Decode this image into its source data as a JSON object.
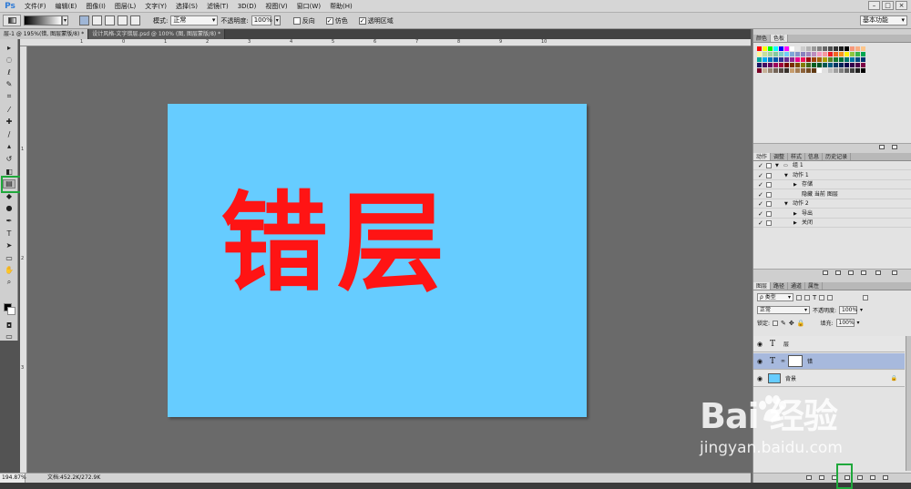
{
  "app": {
    "logo": "Ps",
    "menu": [
      "文件(F)",
      "编辑(E)",
      "图像(I)",
      "图层(L)",
      "文字(Y)",
      "选择(S)",
      "滤镜(T)",
      "3D(D)",
      "视图(V)",
      "窗口(W)",
      "帮助(H)"
    ],
    "window_buttons": [
      "–",
      "□",
      "×"
    ]
  },
  "options_bar": {
    "mode_label": "模式:",
    "mode_value": "正常",
    "opacity_label": "不透明度:",
    "opacity_value": "100%",
    "reverse_label": "反向",
    "dither_label": "仿色",
    "transparency_label": "透明区域",
    "reverse_checked": false,
    "dither_checked": true,
    "transparency_checked": true,
    "workspace": "基本功能"
  },
  "document_tabs": [
    {
      "title": "层-1 @ 195%(错, 图层蒙版/8) *",
      "active": true
    },
    {
      "title": "设计风格-文字错层.psd @ 100% (图, 图层蒙版/8) *",
      "active": false
    }
  ],
  "rulers": {
    "top_ticks": [
      "1",
      "0",
      "1",
      "2",
      "3",
      "4",
      "5",
      "6",
      "7",
      "8",
      "9",
      "10"
    ],
    "left_ticks": [
      "1",
      "2",
      "3"
    ]
  },
  "toolbox": {
    "tools": [
      {
        "name": "move-tool-icon",
        "glyph": "▸"
      },
      {
        "name": "marquee-tool-icon",
        "glyph": "◌"
      },
      {
        "name": "lasso-tool-icon",
        "glyph": "ℓ"
      },
      {
        "name": "quick-select-tool-icon",
        "glyph": "✎"
      },
      {
        "name": "crop-tool-icon",
        "glyph": "⌗"
      },
      {
        "name": "eyedropper-tool-icon",
        "glyph": "⁄"
      },
      {
        "name": "healing-brush-tool-icon",
        "glyph": "✚"
      },
      {
        "name": "brush-tool-icon",
        "glyph": "∕"
      },
      {
        "name": "clone-stamp-tool-icon",
        "glyph": "▴"
      },
      {
        "name": "history-brush-tool-icon",
        "glyph": "↺"
      },
      {
        "name": "eraser-tool-icon",
        "glyph": "◧"
      },
      {
        "name": "gradient-tool-icon",
        "glyph": "▤"
      },
      {
        "name": "blur-tool-icon",
        "glyph": "◆"
      },
      {
        "name": "dodge-tool-icon",
        "glyph": "●"
      },
      {
        "name": "pen-tool-icon",
        "glyph": "✒"
      },
      {
        "name": "type-tool-icon",
        "glyph": "T"
      },
      {
        "name": "path-select-tool-icon",
        "glyph": "➤"
      },
      {
        "name": "shape-tool-icon",
        "glyph": "▭"
      },
      {
        "name": "hand-tool-icon",
        "glyph": "✋"
      },
      {
        "name": "zoom-tool-icon",
        "glyph": "⌕"
      }
    ],
    "selected_tool": "gradient-tool-icon"
  },
  "canvas": {
    "background": "#66ccff",
    "text": "错层",
    "text_color": "#ff1414"
  },
  "status": {
    "zoom": "194.87%",
    "doc_info": "文档:452.2K/272.9K"
  },
  "panels": {
    "swatches": {
      "tabs": [
        "颜色",
        "色板"
      ],
      "active_tab": "色板",
      "colors": [
        "#ff0000",
        "#ffff00",
        "#00ff00",
        "#00ffff",
        "#0000ff",
        "#ff00ff",
        "#ffffff",
        "#e6e6e6",
        "#cccccc",
        "#b3b3b3",
        "#999999",
        "#808080",
        "#666666",
        "#4d4d4d",
        "#333333",
        "#1a1a1a",
        "#000000",
        "#f7977a",
        "#f9ad81",
        "#fdc68a",
        "#fff79a",
        "#c4df9b",
        "#a2d39c",
        "#82ca9d",
        "#7bcdc8",
        "#6ecff6",
        "#7ea7d8",
        "#8493ca",
        "#8882be",
        "#a187be",
        "#bc8dbf",
        "#f49ac2",
        "#f6989d",
        "#ed1c24",
        "#f26522",
        "#f7941d",
        "#fff200",
        "#8dc73f",
        "#39b54a",
        "#00a651",
        "#00a99d",
        "#00aeef",
        "#0072bc",
        "#0054a6",
        "#2e3192",
        "#662d91",
        "#92278f",
        "#ec008c",
        "#ed145b",
        "#9e0b0f",
        "#a0410d",
        "#a36209",
        "#aba000",
        "#598527",
        "#1a7b30",
        "#007236",
        "#00746b",
        "#0076a3",
        "#004b80",
        "#003471",
        "#1b1464",
        "#440e62",
        "#630460",
        "#9e005d",
        "#9e0039",
        "#790000",
        "#7b2e00",
        "#7d4900",
        "#827b00",
        "#406618",
        "#005e20",
        "#005826",
        "#005952",
        "#005b7f",
        "#003663",
        "#002157",
        "#0d004c",
        "#32004b",
        "#4b0049",
        "#7b0046",
        "#7a0026",
        "#c7b299",
        "#998675",
        "#736357",
        "#534741",
        "#37302a",
        "#c69c6d",
        "#a67c52",
        "#8c6239",
        "#754c24",
        "#603913",
        "#ffffff",
        "#e0e0e0",
        "#c0c0c0",
        "#a0a0a0",
        "#808080",
        "#606060",
        "#404040",
        "#202020",
        "#000000"
      ]
    },
    "actions": {
      "tabs": [
        "动作",
        "调整",
        "样式",
        "信息",
        "历史记录"
      ],
      "active_tab": "动作",
      "rows": [
        {
          "label": "组 1",
          "indent": 0,
          "expanded": true,
          "folder": true
        },
        {
          "label": "动作 1",
          "indent": 1,
          "expanded": true,
          "folder": false
        },
        {
          "label": "存储",
          "indent": 2,
          "expanded": false,
          "folder": false
        },
        {
          "label": "隐藏 当前 图层",
          "indent": 2,
          "expanded": null,
          "folder": false
        },
        {
          "label": "动作 2",
          "indent": 1,
          "expanded": true,
          "folder": false
        },
        {
          "label": "导出",
          "indent": 2,
          "expanded": false,
          "folder": false
        },
        {
          "label": "关闭",
          "indent": 2,
          "expanded": false,
          "folder": false
        }
      ]
    },
    "layers": {
      "tabs": [
        "图层",
        "路径",
        "通道",
        "属性"
      ],
      "active_tab": "图层",
      "filter": "ρ 类型",
      "blend_mode": "正常",
      "opacity_label": "不透明度:",
      "opacity": "100%",
      "lock_label": "锁定:",
      "fill_label": "填充:",
      "fill": "100%",
      "items": [
        {
          "name": "层",
          "kind": "text",
          "selected": false
        },
        {
          "name": "错",
          "kind": "text-mask",
          "selected": true
        },
        {
          "name": "背景",
          "kind": "background",
          "selected": false
        }
      ],
      "footer_icons": [
        "link-icon",
        "fx-icon",
        "add-mask-icon",
        "adjustment-icon",
        "group-icon",
        "new-layer-icon",
        "trash-icon"
      ]
    }
  },
  "watermark": {
    "logo": "Bai  经验",
    "url": "jingyan.baidu.com"
  }
}
